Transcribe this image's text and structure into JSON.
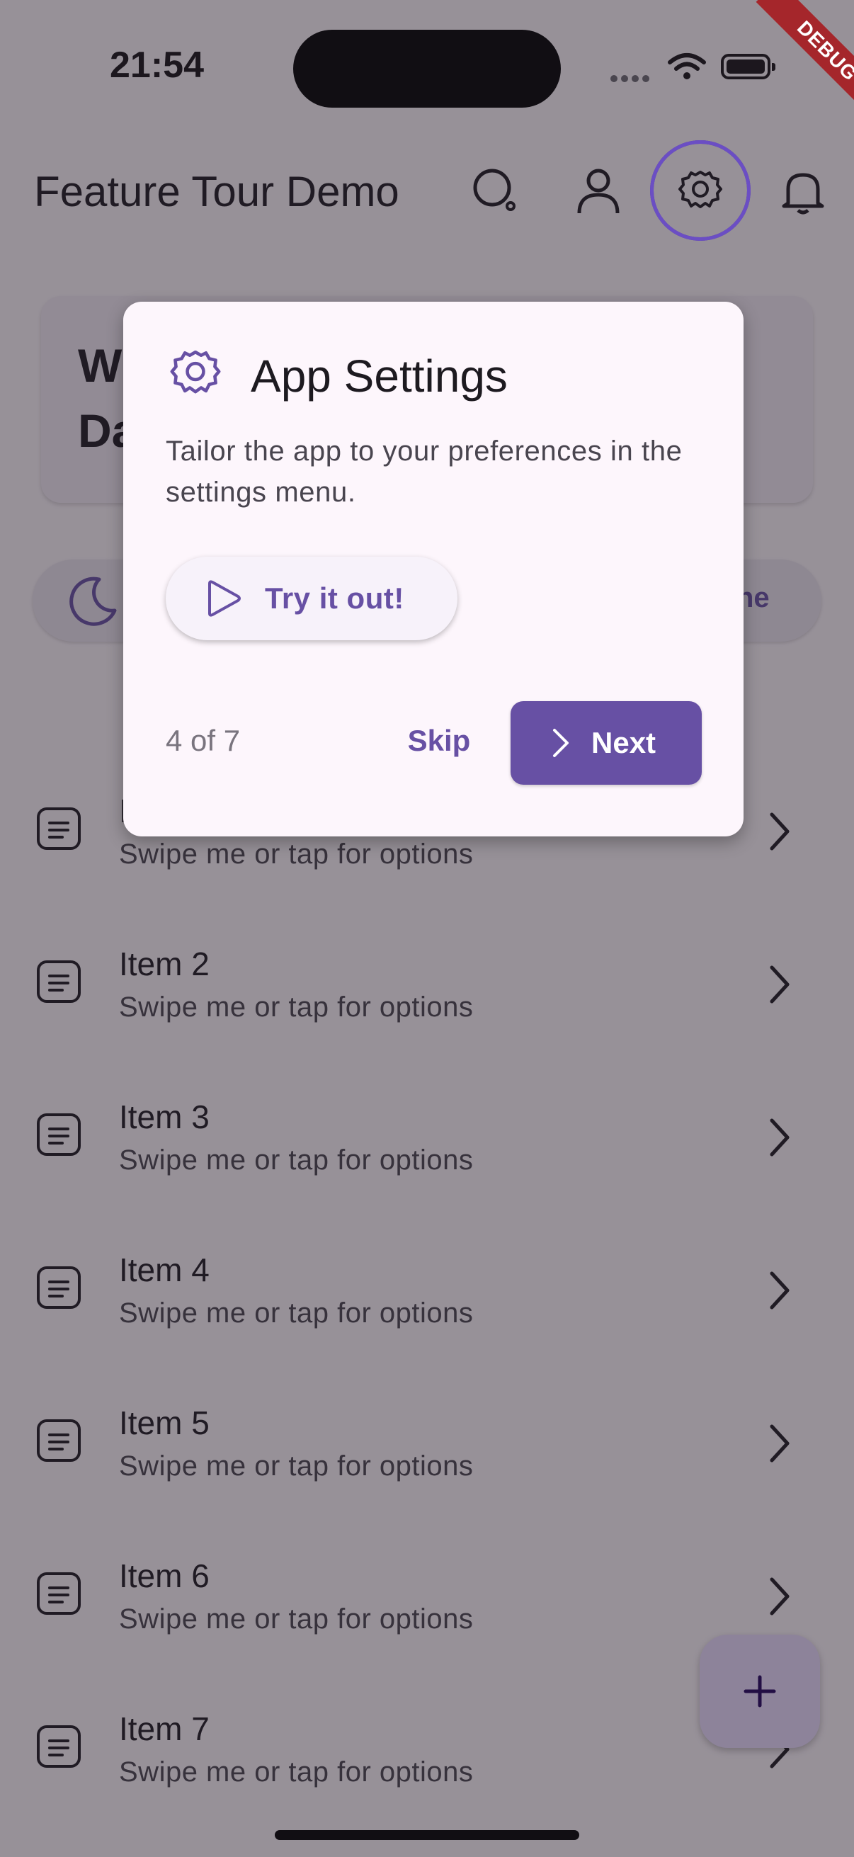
{
  "status_bar": {
    "time": "21:54",
    "debug_label": "DEBUG"
  },
  "app_bar": {
    "title": "Feature Tour Demo",
    "actions": [
      "search-icon",
      "person-icon",
      "settings-icon",
      "notifications-icon"
    ]
  },
  "hero": {
    "line1": "W",
    "line2": "Da"
  },
  "chips": {
    "right_fragment": "ne"
  },
  "list": {
    "items": [
      {
        "title": "Item 1",
        "subtitle": "Swipe me or tap for options"
      },
      {
        "title": "Item 2",
        "subtitle": "Swipe me or tap for options"
      },
      {
        "title": "Item 3",
        "subtitle": "Swipe me or tap for options"
      },
      {
        "title": "Item 4",
        "subtitle": "Swipe me or tap for options"
      },
      {
        "title": "Item 5",
        "subtitle": "Swipe me or tap for options"
      },
      {
        "title": "Item 6",
        "subtitle": "Swipe me or tap for options"
      },
      {
        "title": "Item 7",
        "subtitle": "Swipe me or tap for options"
      }
    ]
  },
  "fab": {
    "icon": "add-icon"
  },
  "tour_dialog": {
    "title": "App Settings",
    "body": "Tailor the app to your preferences in the settings menu.",
    "try_label": "Try it out!",
    "step": "4 of 7",
    "skip_label": "Skip",
    "next_label": "Next"
  },
  "colors": {
    "primary": "#6750a4",
    "highlight_ring": "#6b4ec4",
    "debug": "#a5262b"
  }
}
